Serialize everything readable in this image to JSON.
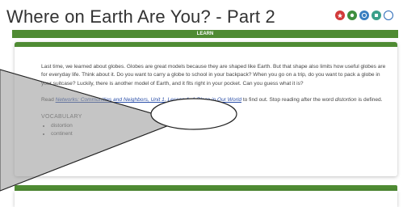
{
  "header": {
    "title": "Where on Earth Are You? - Part 2",
    "icons": [
      {
        "name": "red-circle-icon",
        "color": "#d23a3a"
      },
      {
        "name": "green-circle-icon",
        "color": "#3e8e3e"
      },
      {
        "name": "blue-circle-icon",
        "color": "#3a7fc1"
      },
      {
        "name": "teal-circle-icon",
        "color": "#3aa08a"
      },
      {
        "name": "outline-circle-icon",
        "color": "#2a6ab8"
      }
    ]
  },
  "learn_bar": {
    "label": "LEARN"
  },
  "content": {
    "paragraph1": "Last time, we learned about globes. Globes are great models because they are shaped like Earth. But that shape also limits how useful globes are for everyday life. Think about it. Do you want to carry a globe to school in your backpack? When you go on a trip, do you want to pack a globe in your suitcase? Luckily, there is another model of Earth, and it fits right in your pocket. Can you guess what it is?",
    "read_prefix": "Read ",
    "read_link": "Networks: Communities and Neighbors, Unit 1, Lesson 1, A Place in Our World",
    "read_suffix": " to find out. Stop reading after the word ",
    "read_term": "distortion",
    "read_end": " is defined.",
    "vocab_heading": "VOCABULARY",
    "vocab_items": [
      "distortion",
      "continent"
    ]
  },
  "colors": {
    "accent_green": "#4f8b33",
    "link": "#2b4fa8"
  }
}
